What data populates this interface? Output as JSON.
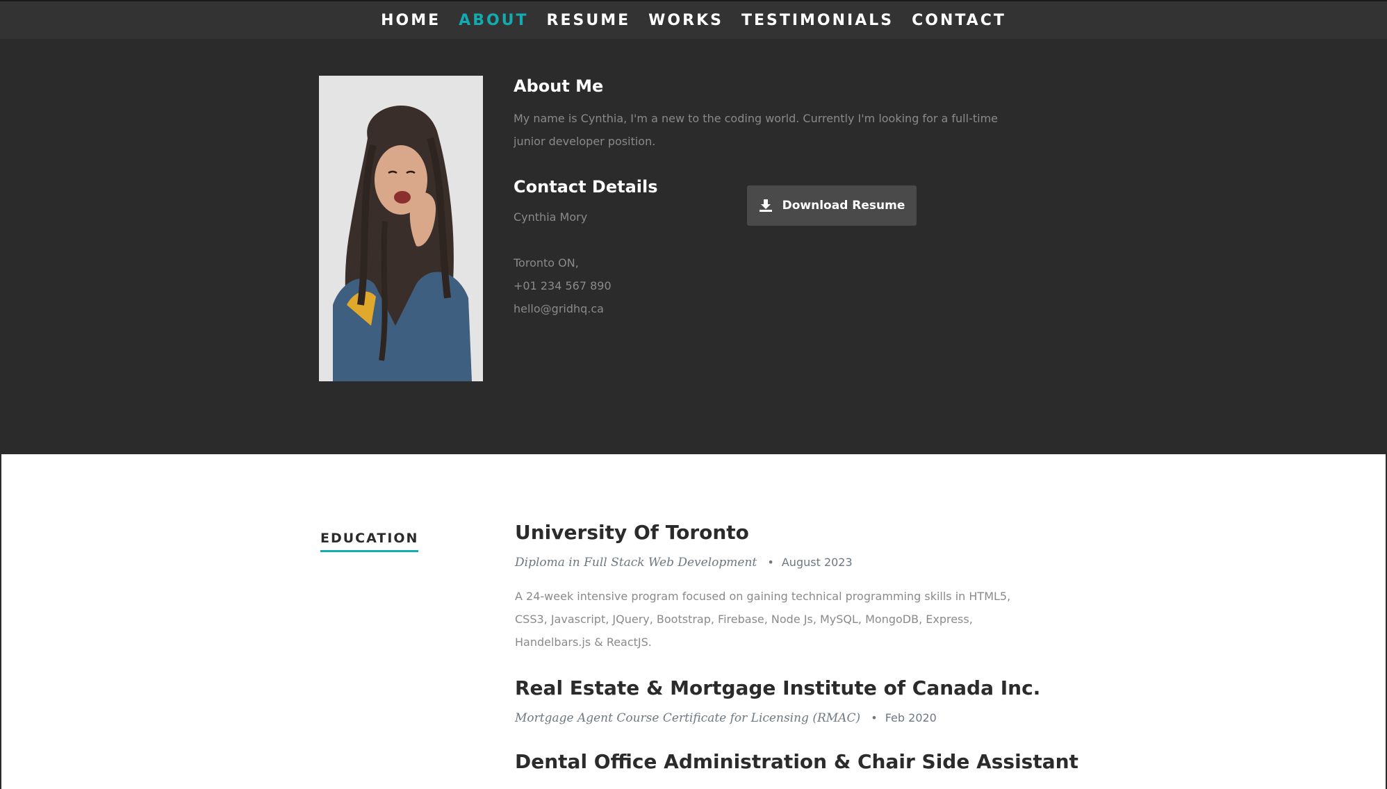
{
  "nav": {
    "items": [
      {
        "label": "HOME"
      },
      {
        "label": "ABOUT",
        "active": true
      },
      {
        "label": "RESUME"
      },
      {
        "label": "WORKS"
      },
      {
        "label": "TESTIMONIALS"
      },
      {
        "label": "CONTACT"
      }
    ]
  },
  "about": {
    "title": "About Me",
    "text": "My name is Cynthia, I'm a new to the coding world. Currently I'm looking for a full-time junior developer position."
  },
  "contact": {
    "title": "Contact Details",
    "name": "Cynthia Mory",
    "address": "Toronto ON,",
    "phone": "+01 234 567 890",
    "email": "hello@gridhq.ca",
    "download_label": "Download Resume"
  },
  "education": {
    "heading": "EDUCATION",
    "entries": [
      {
        "school": "University Of Toronto",
        "degree": "Diploma in Full Stack Web Development",
        "bullet": "•",
        "date": "August 2023",
        "description": "A 24-week intensive program focused on gaining technical programming skills in HTML5, CSS3, Javascript, JQuery, Bootstrap, Firebase, Node Js, MySQL, MongoDB, Express, Handelbars.js & ReactJS."
      },
      {
        "school": "Real Estate & Mortgage Institute of Canada Inc.",
        "degree": "Mortgage Agent Course Certificate for Licensing (RMAC)",
        "bullet": "•",
        "date": "Feb 2020"
      },
      {
        "school": "Dental Office Administration & Chair Side Assistant"
      }
    ]
  },
  "colors": {
    "accent": "#11abb0",
    "nav_bg": "#333333",
    "about_bg": "#2b2b2b",
    "button_bg": "#4a4a4a"
  },
  "icons": {
    "download": "download-icon"
  }
}
